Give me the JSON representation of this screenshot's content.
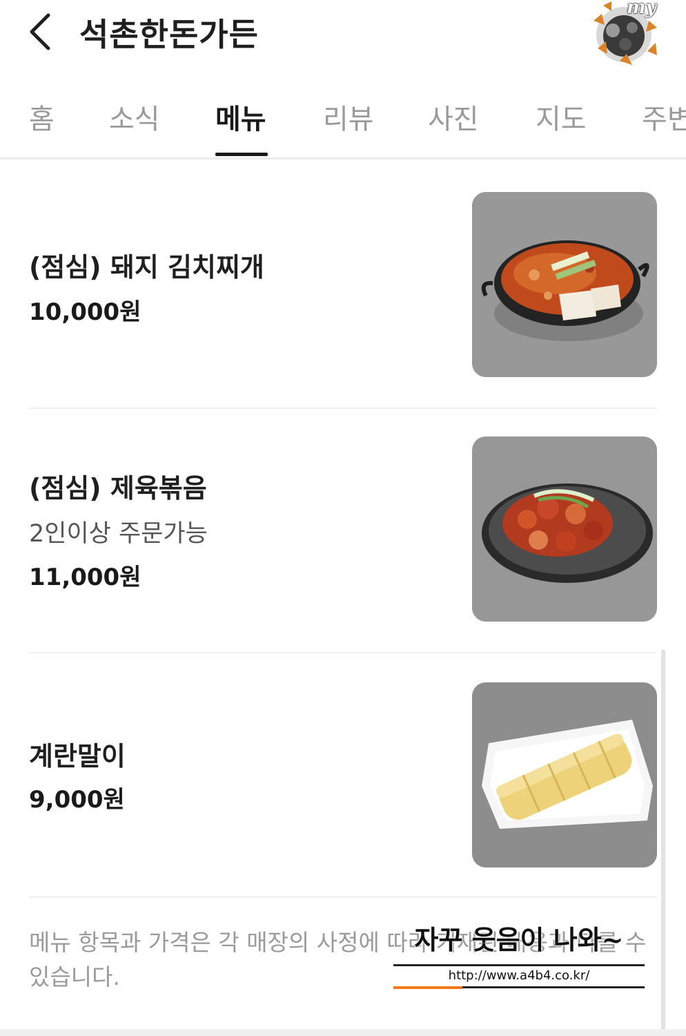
{
  "header": {
    "title": "석촌한돈가든",
    "avatar_text": "my"
  },
  "tabs": [
    {
      "label": "홈"
    },
    {
      "label": "소식"
    },
    {
      "label": "메뉴"
    },
    {
      "label": "리뷰"
    },
    {
      "label": "사진"
    },
    {
      "label": "지도"
    },
    {
      "label": "주변"
    }
  ],
  "active_tab": "메뉴",
  "menu_items": [
    {
      "name": "(점심) 돼지 김치찌개",
      "description": "",
      "price": "10,000원",
      "photo": "kimchi-stew-photo"
    },
    {
      "name": "(점심) 제육볶음",
      "description": "2인이상 주문가능",
      "price": "11,000원",
      "photo": "spicy-pork-photo"
    },
    {
      "name": "계란말이",
      "description": "",
      "price": "9,000원",
      "photo": "rolled-omelette-photo"
    }
  ],
  "notice": "메뉴 항목과 가격은 각 매장의 사정에 따라 기재된 내용과 다를 수 있습니다.",
  "watermark": {
    "text": "자꾸 웃음이 나와~",
    "url": "http://www.a4b4.co.kr/"
  },
  "colors": {
    "text": "#1a1a1a",
    "muted": "#9a9a9a",
    "divider": "#efefef",
    "watermark_accent": "#f07a1a"
  }
}
